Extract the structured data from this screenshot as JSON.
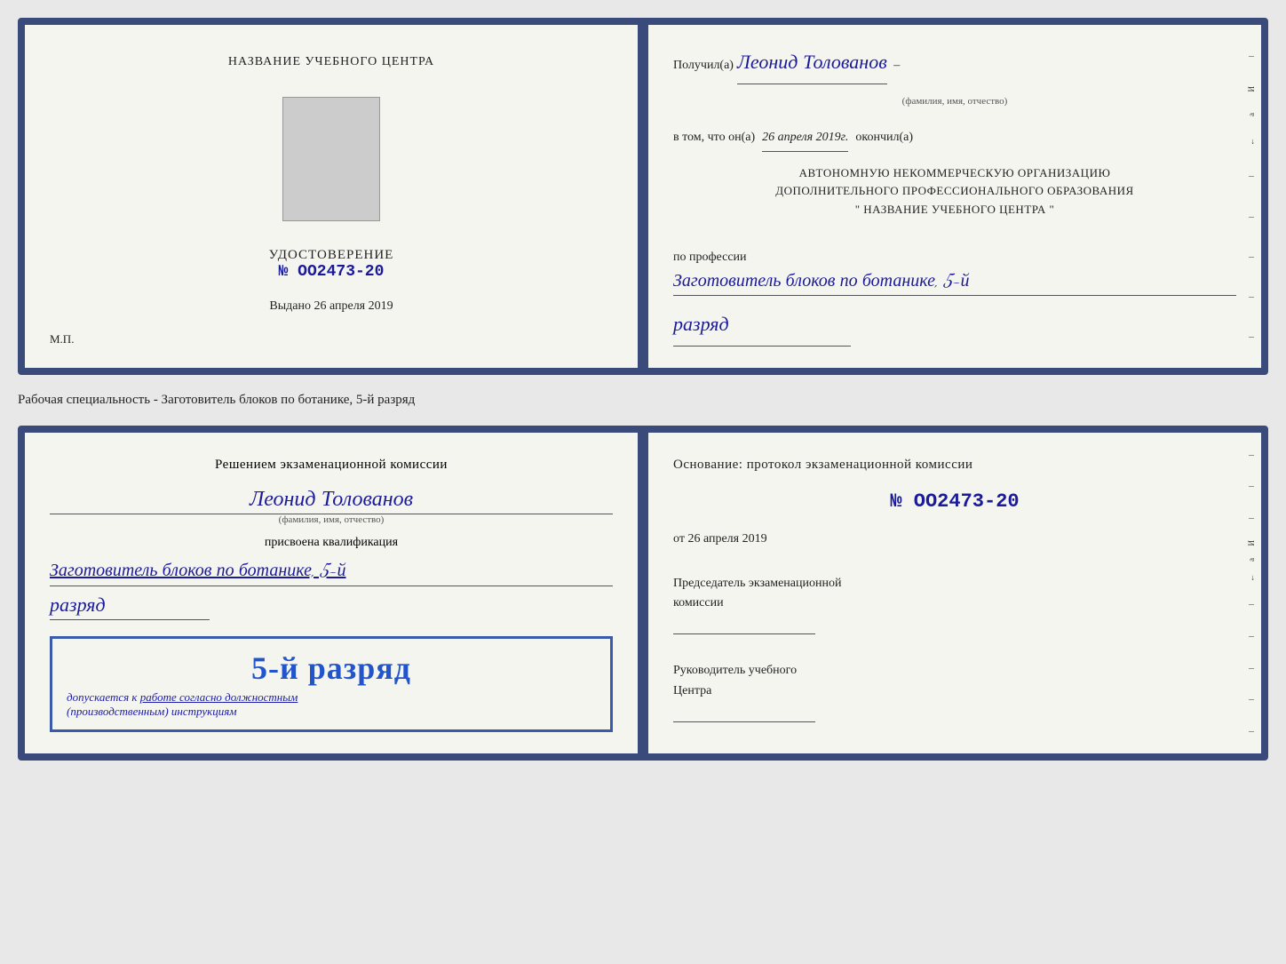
{
  "topDoc": {
    "left": {
      "schoolNameLabel": "НАЗВАНИЕ УЧЕБНОГО ЦЕНТРА",
      "certTitle": "УДОСТОВЕРЕНИЕ",
      "certNumber": "№ OO2473-20",
      "issuedLabel": "Выдано",
      "issuedDate": "26 апреля 2019",
      "mpLabel": "М.П."
    },
    "right": {
      "recipientPrefix": "Получил(а)",
      "recipientName": "Леонид Толованов",
      "fioLabel": "(фамилия, имя, отчество)",
      "certifiedText": "в том, что он(а)",
      "certifiedDate": "26 апреля 2019г.",
      "completedLabel": "окончил(а)",
      "org1": "АВТОНОМНУЮ НЕКОММЕРЧЕСКУЮ ОРГАНИЗАЦИЮ",
      "org2": "ДОПОЛНИТЕЛЬНОГО ПРОФЕССИОНАЛЬНОГО ОБРАЗОВАНИЯ",
      "org3": "\"    НАЗВАНИЕ УЧЕБНОГО ЦЕНТРА    \"",
      "professionLabel": "по профессии",
      "professionValue": "Заготовитель блоков по ботанике, 5-й",
      "razryadValue": "разряд"
    }
  },
  "specialtyLabel": "Рабочая специальность - Заготовитель блоков по ботанике, 5-й разряд",
  "bottomDoc": {
    "left": {
      "decisionText": "Решением экзаменационной комиссии",
      "personName": "Леонид Толованов",
      "fioLabel": "(фамилия, имя, отчество)",
      "qualificationAssigned": "присвоена квалификация",
      "qualificationValue": "Заготовитель блоков по ботанике, 5-й",
      "razryadValue": "разряд",
      "stampGrade": "5-й разряд",
      "stampText1": "допускается к",
      "stampText2": "работе согласно должностным",
      "stampText3": "(производственным) инструкциям"
    },
    "right": {
      "basisLabel": "Основание: протокол экзаменационной комиссии",
      "protocolNumber": "№  OO2473-20",
      "protocolDatePrefix": "от",
      "protocolDate": "26 апреля 2019",
      "chairmanLabel1": "Председатель экзаменационной",
      "chairmanLabel2": "комиссии",
      "headLabel1": "Руководитель учебного",
      "headLabel2": "Центра"
    }
  },
  "rightEdgeLabels": [
    "–",
    "И",
    "а",
    "←",
    "–",
    "–",
    "–",
    "–",
    "–"
  ]
}
